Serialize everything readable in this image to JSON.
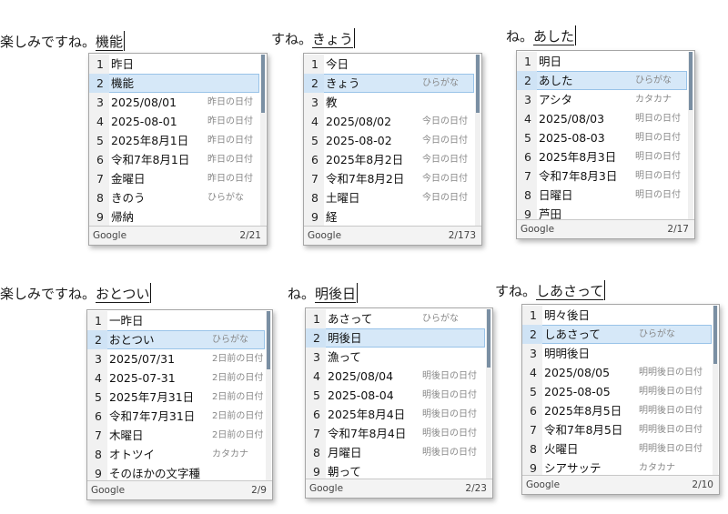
{
  "panels": [
    {
      "composition": {
        "prefix": "楽しみですね。",
        "text": "機能"
      },
      "candidates": [
        {
          "n": "1",
          "text": "昨日",
          "note": ""
        },
        {
          "n": "2",
          "text": "機能",
          "note": ""
        },
        {
          "n": "3",
          "text": "2025/08/01",
          "note": "昨日の日付"
        },
        {
          "n": "4",
          "text": "2025-08-01",
          "note": "昨日の日付"
        },
        {
          "n": "5",
          "text": "2025年8月1日",
          "note": "昨日の日付"
        },
        {
          "n": "6",
          "text": "令和7年8月1日",
          "note": "昨日の日付"
        },
        {
          "n": "7",
          "text": "金曜日",
          "note": "昨日の日付"
        },
        {
          "n": "8",
          "text": "きのう",
          "note": "ひらがな"
        },
        {
          "n": "9",
          "text": "帰納",
          "note": ""
        }
      ],
      "selected_index": 1,
      "footer": {
        "brand": "Google",
        "page": "2/21"
      }
    },
    {
      "composition": {
        "prefix": "すね。",
        "text": "きょう"
      },
      "candidates": [
        {
          "n": "1",
          "text": "今日",
          "note": ""
        },
        {
          "n": "2",
          "text": "きょう",
          "note": "ひらがな"
        },
        {
          "n": "3",
          "text": "教",
          "note": ""
        },
        {
          "n": "4",
          "text": "2025/08/02",
          "note": "今日の日付"
        },
        {
          "n": "5",
          "text": "2025-08-02",
          "note": "今日の日付"
        },
        {
          "n": "6",
          "text": "2025年8月2日",
          "note": "今日の日付"
        },
        {
          "n": "7",
          "text": "令和7年8月2日",
          "note": "今日の日付"
        },
        {
          "n": "8",
          "text": "土曜日",
          "note": "今日の日付"
        },
        {
          "n": "9",
          "text": "経",
          "note": ""
        }
      ],
      "selected_index": 1,
      "footer": {
        "brand": "Google",
        "page": "2/173"
      }
    },
    {
      "composition": {
        "prefix": "ね。",
        "text": "あした"
      },
      "candidates": [
        {
          "n": "1",
          "text": "明日",
          "note": ""
        },
        {
          "n": "2",
          "text": "あした",
          "note": "ひらがな"
        },
        {
          "n": "3",
          "text": "アシタ",
          "note": "カタカナ"
        },
        {
          "n": "4",
          "text": "2025/08/03",
          "note": "明日の日付"
        },
        {
          "n": "5",
          "text": "2025-08-03",
          "note": "明日の日付"
        },
        {
          "n": "6",
          "text": "2025年8月3日",
          "note": "明日の日付"
        },
        {
          "n": "7",
          "text": "令和7年8月3日",
          "note": "明日の日付"
        },
        {
          "n": "8",
          "text": "日曜日",
          "note": "明日の日付"
        },
        {
          "n": "9",
          "text": "芦田",
          "note": ""
        }
      ],
      "selected_index": 1,
      "footer": {
        "brand": "Google",
        "page": "2/17"
      }
    },
    {
      "composition": {
        "prefix": "楽しみですね。",
        "text": "おとつい"
      },
      "candidates": [
        {
          "n": "1",
          "text": "一昨日",
          "note": ""
        },
        {
          "n": "2",
          "text": "おとつい",
          "note": "ひらがな"
        },
        {
          "n": "3",
          "text": "2025/07/31",
          "note": "2日前の日付"
        },
        {
          "n": "4",
          "text": "2025-07-31",
          "note": "2日前の日付"
        },
        {
          "n": "5",
          "text": "2025年7月31日",
          "note": "2日前の日付"
        },
        {
          "n": "6",
          "text": "令和7年7月31日",
          "note": "2日前の日付"
        },
        {
          "n": "7",
          "text": "木曜日",
          "note": "2日前の日付"
        },
        {
          "n": "8",
          "text": "オトツイ",
          "note": "カタカナ"
        },
        {
          "n": "9",
          "text": "そのほかの文字種",
          "note": ""
        }
      ],
      "selected_index": 1,
      "footer": {
        "brand": "Google",
        "page": "2/9"
      }
    },
    {
      "composition": {
        "prefix": "ね。",
        "text": "明後日"
      },
      "candidates": [
        {
          "n": "1",
          "text": "あさって",
          "note": "ひらがな"
        },
        {
          "n": "2",
          "text": "明後日",
          "note": ""
        },
        {
          "n": "3",
          "text": "漁って",
          "note": ""
        },
        {
          "n": "4",
          "text": "2025/08/04",
          "note": "明後日の日付"
        },
        {
          "n": "5",
          "text": "2025-08-04",
          "note": "明後日の日付"
        },
        {
          "n": "6",
          "text": "2025年8月4日",
          "note": "明後日の日付"
        },
        {
          "n": "7",
          "text": "令和7年8月4日",
          "note": "明後日の日付"
        },
        {
          "n": "8",
          "text": "月曜日",
          "note": "明後日の日付"
        },
        {
          "n": "9",
          "text": "朝って",
          "note": ""
        }
      ],
      "selected_index": 1,
      "footer": {
        "brand": "Google",
        "page": "2/23"
      }
    },
    {
      "composition": {
        "prefix": "すね。",
        "text": "しあさって"
      },
      "candidates": [
        {
          "n": "1",
          "text": "明々後日",
          "note": ""
        },
        {
          "n": "2",
          "text": "しあさって",
          "note": "ひらがな"
        },
        {
          "n": "3",
          "text": "明明後日",
          "note": ""
        },
        {
          "n": "4",
          "text": "2025/08/05",
          "note": "明明後日の日付"
        },
        {
          "n": "5",
          "text": "2025-08-05",
          "note": "明明後日の日付"
        },
        {
          "n": "6",
          "text": "2025年8月5日",
          "note": "明明後日の日付"
        },
        {
          "n": "7",
          "text": "令和7年8月5日",
          "note": "明明後日の日付"
        },
        {
          "n": "8",
          "text": "火曜日",
          "note": "明明後日の日付"
        },
        {
          "n": "9",
          "text": "シアサッテ",
          "note": "カタカナ"
        }
      ],
      "selected_index": 1,
      "footer": {
        "brand": "Google",
        "page": "2/10"
      }
    }
  ]
}
